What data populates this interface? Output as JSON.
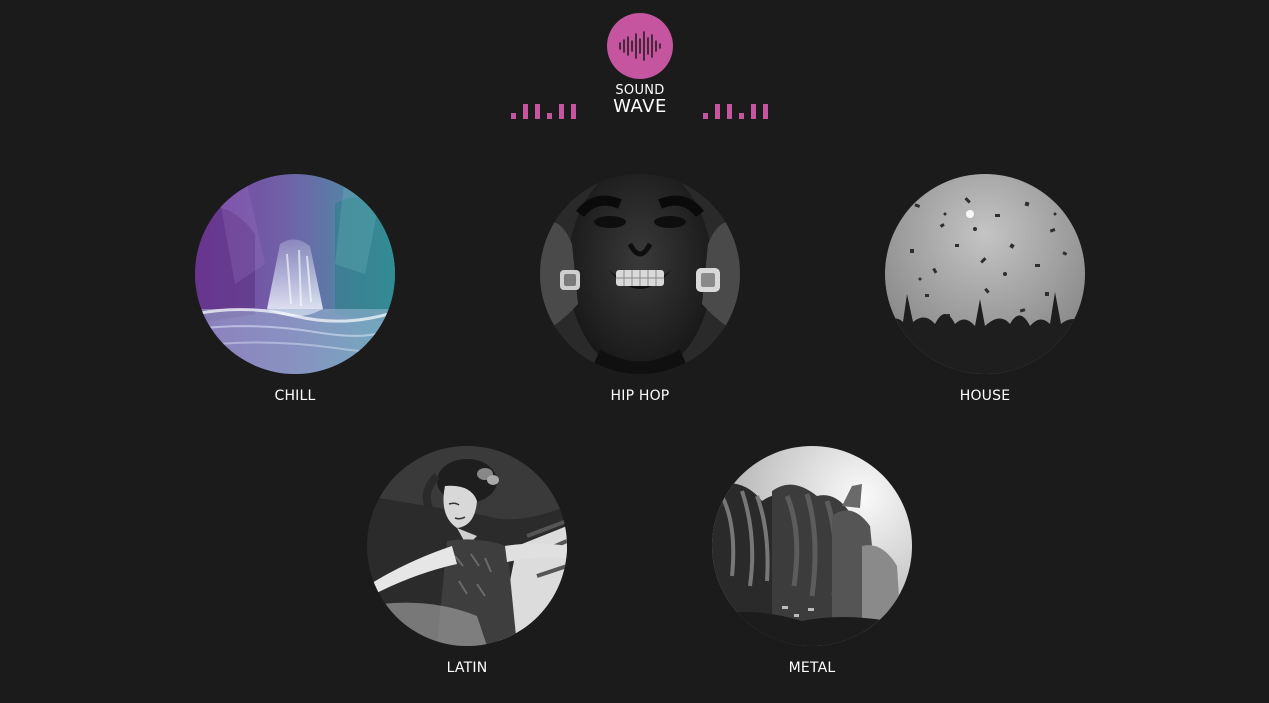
{
  "brand": {
    "line1": "SOUND",
    "line2": "WAVE",
    "accent_color": "#c4559e",
    "logo_icon": "soundwave-icon",
    "decor_icon": "equalizer-bars-icon"
  },
  "genres": [
    {
      "id": "chill",
      "label": "CHILL",
      "image": "waterfall-photo"
    },
    {
      "id": "hiphop",
      "label": "HIP HOP",
      "image": "grill-smile-portrait"
    },
    {
      "id": "house",
      "label": "HOUSE",
      "image": "confetti-crowd-photo"
    },
    {
      "id": "latin",
      "label": "LATIN",
      "image": "flamenco-dancer-painting"
    },
    {
      "id": "metal",
      "label": "METAL",
      "image": "headbanging-crowd-photo"
    }
  ]
}
